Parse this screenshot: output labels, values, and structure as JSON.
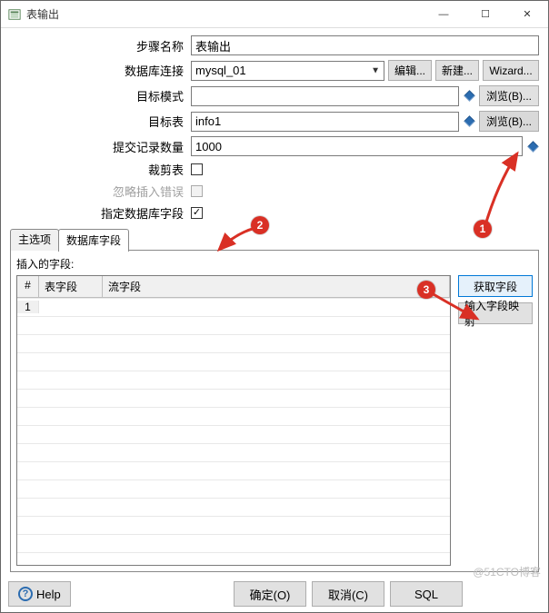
{
  "window": {
    "title": "表输出"
  },
  "titlebar_buttons": {
    "min": "—",
    "max": "☐",
    "close": "✕"
  },
  "form": {
    "step_name": {
      "label": "步骤名称",
      "value": "表输出"
    },
    "db_conn": {
      "label": "数据库连接",
      "value": "mysql_01",
      "buttons": {
        "edit": "编辑...",
        "new": "新建...",
        "wizard": "Wizard..."
      }
    },
    "target_schema": {
      "label": "目标模式",
      "value": "",
      "browse": "浏览(B)..."
    },
    "target_table": {
      "label": "目标表",
      "value": "info1",
      "browse": "浏览(B)..."
    },
    "commit_size": {
      "label": "提交记录数量",
      "value": "1000"
    },
    "truncate": {
      "label": "裁剪表",
      "checked": false
    },
    "ignore_errors": {
      "label": "忽略插入错误",
      "checked": false,
      "disabled": true
    },
    "specify_fields": {
      "label": "指定数据库字段",
      "checked": true
    }
  },
  "tabs": {
    "main": "主选项",
    "db_fields": "数据库字段",
    "active": "db_fields"
  },
  "grid": {
    "caption": "插入的字段:",
    "columns": {
      "num": "#",
      "table_field": "表字段",
      "stream_field": "流字段"
    },
    "rows": [
      {
        "num": "1",
        "table_field": "",
        "stream_field": ""
      }
    ]
  },
  "side_buttons": {
    "get_fields": "获取字段",
    "mapping": "输入字段映射"
  },
  "footer": {
    "help": "Help",
    "ok": "确定(O)",
    "cancel": "取消(C)",
    "sql": "SQL"
  },
  "callouts": {
    "c1": "1",
    "c2": "2",
    "c3": "3"
  },
  "watermark": "@51CTO博客"
}
